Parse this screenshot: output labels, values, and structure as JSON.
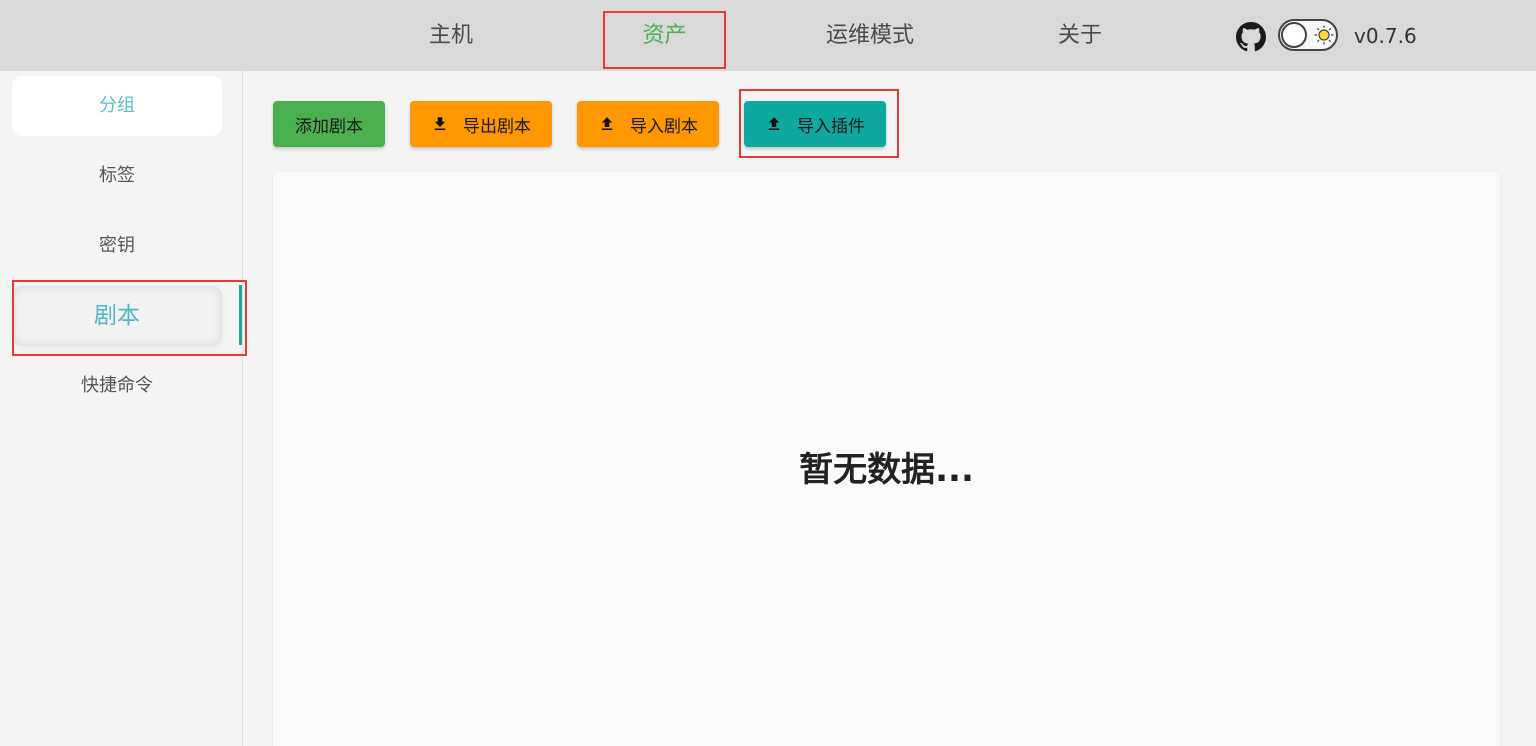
{
  "nav": {
    "items": [
      {
        "label": "主机"
      },
      {
        "label": "资产"
      },
      {
        "label": "运维模式"
      },
      {
        "label": "关于"
      }
    ],
    "active_index": 1,
    "version": "v0.7.6",
    "icons": {
      "github": "github-icon",
      "theme_toggle": "theme-toggle",
      "sun": "sun-icon"
    }
  },
  "sidebar": {
    "items": [
      {
        "label": "分组"
      },
      {
        "label": "标签"
      },
      {
        "label": "密钥"
      },
      {
        "label": "剧本"
      },
      {
        "label": "快捷命令"
      }
    ],
    "selected_index": 3
  },
  "toolbar": {
    "add_script": "添加剧本",
    "export_script": "导出剧本",
    "import_script": "导入剧本",
    "import_plugin": "导入插件",
    "icons": {
      "export": "download-icon",
      "import": "upload-icon"
    }
  },
  "content": {
    "empty_text": "暂无数据..."
  },
  "colors": {
    "active_nav": "#4caf50",
    "sidebar_accent": "#4fb7c5",
    "btn_green": "#4caf50",
    "btn_orange": "#ff9800",
    "btn_teal": "#0ea8a0",
    "highlight": "#e53935"
  }
}
